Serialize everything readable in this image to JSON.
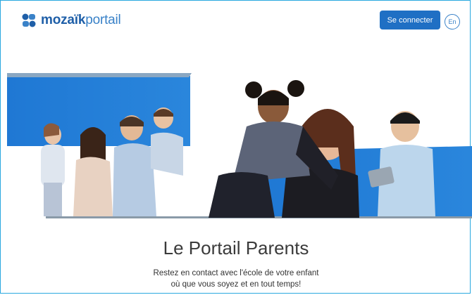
{
  "brand": {
    "name_bold": "mozaïk",
    "name_light": "portail",
    "logo_icon": "mozaik-logo-icon",
    "color_primary": "#1f5fa8",
    "color_accent": "#3a82c8"
  },
  "header": {
    "connect_label": "Se connecter",
    "lang_label": "En"
  },
  "hero": {
    "banner_color": "#1f7ad6",
    "image_description_icon": "family-photo"
  },
  "main": {
    "title": "Le Portail Parents",
    "subtitle_line1": "Restez en contact avec l'école de votre enfant",
    "subtitle_line2": "où que vous soyez et en tout temps!"
  }
}
